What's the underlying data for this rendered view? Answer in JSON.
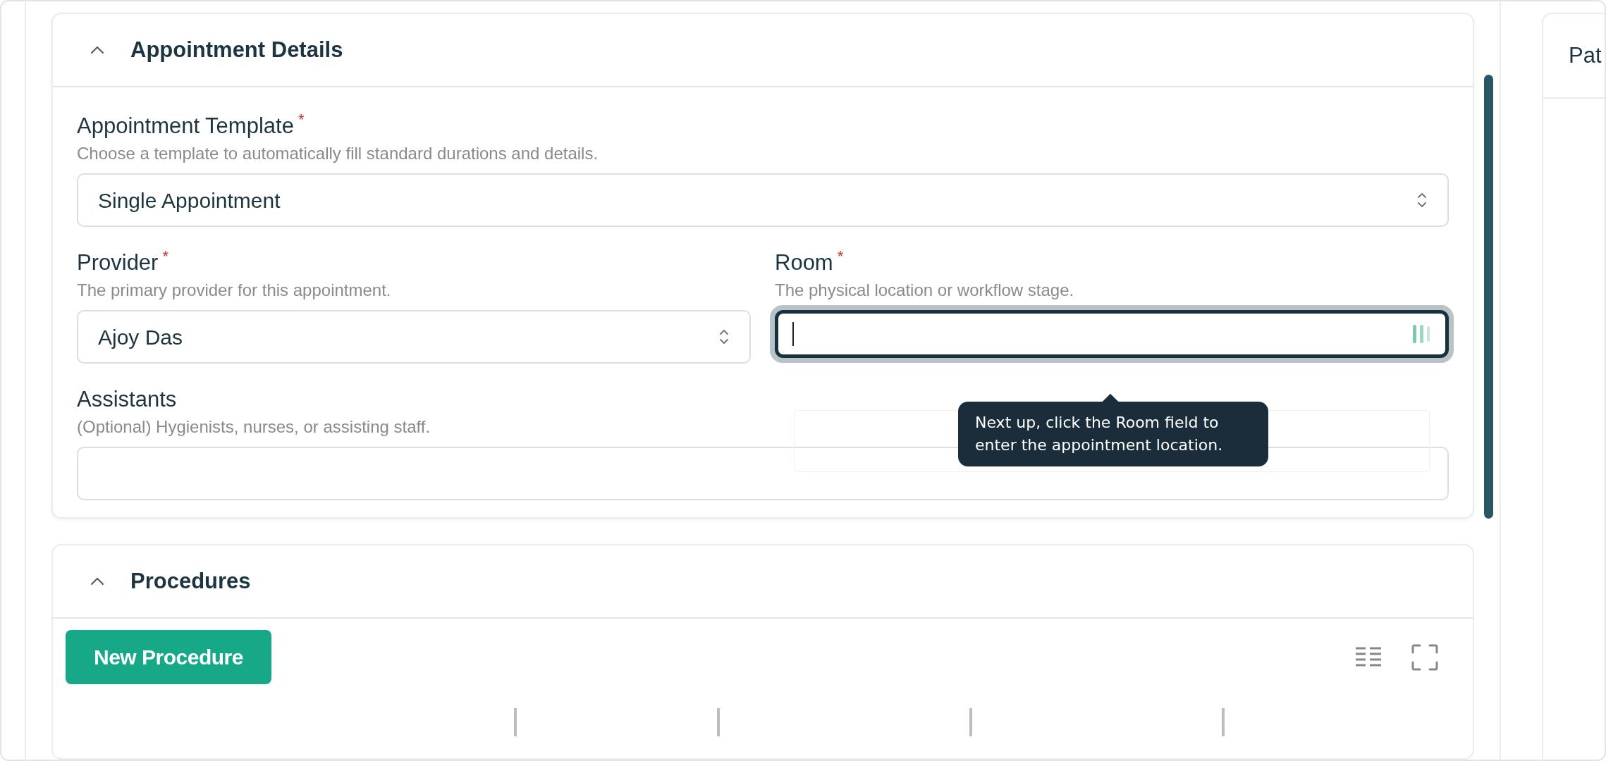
{
  "appointment_details": {
    "title": "Appointment Details",
    "expanded": true,
    "rows": [
      [
        {
          "label": "Appointment Template",
          "required_mark": "*",
          "help": "Choose a template to automatically fill standard durations and details.",
          "kind": "select",
          "value": "Single Appointment",
          "focused": false
        }
      ],
      [
        {
          "label": "Provider",
          "required_mark": "*",
          "help": "The primary provider for this appointment.",
          "kind": "select",
          "value": "Ajoy Das",
          "focused": false
        },
        {
          "label": "Room",
          "required_mark": "*",
          "help": "The physical location or workflow stage.",
          "kind": "text",
          "focused": true,
          "tooltip": "Next up, click the Room field to enter the appointment location."
        }
      ],
      [
        {
          "label": "Assistants",
          "help": "(Optional) Hygienists, nurses, or assisting staff.",
          "kind": "text",
          "focused": false
        }
      ]
    ]
  },
  "procedures": {
    "title": "Procedures",
    "expanded": true,
    "new_button": "New Procedure"
  },
  "side_panel": {
    "title": "Pat"
  }
}
